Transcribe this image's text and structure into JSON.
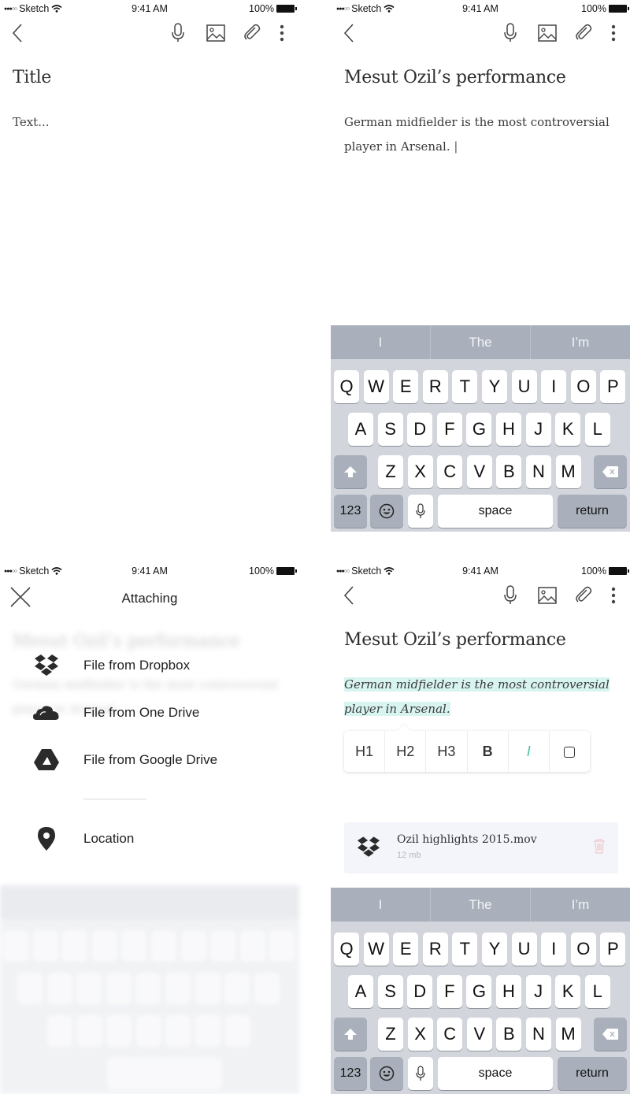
{
  "status_bar": {
    "carrier": "Sketch",
    "time": "9:41 AM",
    "battery": "100%"
  },
  "toolbar": {
    "icons": [
      "back-icon",
      "microphone-icon",
      "image-icon",
      "paperclip-icon",
      "more-vertical-icon"
    ]
  },
  "screen_empty": {
    "title_placeholder": "Title",
    "body_placeholder": "Text..."
  },
  "screen_typing": {
    "title": "Mesut Ozil’s performance",
    "body": "German midfielder is the most controversial player in Arsenal.",
    "caret": "|"
  },
  "screen_attaching": {
    "header": "Attaching",
    "close_icon": "close-icon",
    "items": [
      {
        "label": "File from Dropbox",
        "icon": "dropbox-icon"
      },
      {
        "label": "File from One Drive",
        "icon": "onedrive-icon"
      },
      {
        "label": "File from Google Drive",
        "icon": "google-drive-icon"
      },
      {
        "label": "Location",
        "icon": "location-pin-icon"
      }
    ]
  },
  "screen_formatting": {
    "title": "Mesut Ozil’s performance",
    "body": "German midfielder is the most controversial player in Arsenal.",
    "format_buttons": [
      "H1",
      "H2",
      "H3",
      "B",
      "I",
      "checkbox"
    ],
    "active_format": "I",
    "accent_color": "#4ac0a6",
    "highlight_color": "#d8f4f1",
    "attachment": {
      "filename": "Ozil highlights 2015.mov",
      "size": "12 mb",
      "source_icon": "dropbox-icon",
      "delete_icon": "trash-icon"
    }
  },
  "keyboard": {
    "suggestions": [
      "I",
      "The",
      "I’m"
    ],
    "row1": [
      "Q",
      "W",
      "E",
      "R",
      "T",
      "Y",
      "U",
      "I",
      "O",
      "P"
    ],
    "row2": [
      "A",
      "S",
      "D",
      "F",
      "G",
      "H",
      "J",
      "K",
      "L"
    ],
    "row3": [
      "Z",
      "X",
      "C",
      "V",
      "B",
      "N",
      "M"
    ],
    "numbers_label": "123",
    "space_label": "space",
    "return_label": "return"
  }
}
